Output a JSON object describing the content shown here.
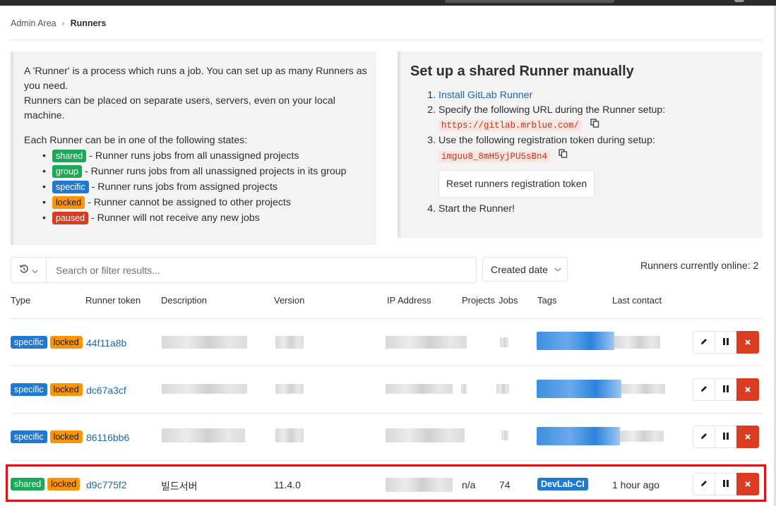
{
  "breadcrumb": {
    "parent": "Admin Area",
    "current": "Runners"
  },
  "info": {
    "line1": "A 'Runner' is a process which runs a job. You can set up as many Runners as you need.",
    "line2": "Runners can be placed on separate users, servers, even on your local machine.",
    "states_intro": "Each Runner can be in one of the following states:",
    "states": [
      {
        "badge": "shared",
        "text": "- Runner runs jobs from all unassigned projects"
      },
      {
        "badge": "group",
        "text": "- Runner runs jobs from all unassigned projects in its group"
      },
      {
        "badge": "specific",
        "text": "- Runner runs jobs from assigned projects"
      },
      {
        "badge": "locked",
        "text": "- Runner cannot be assigned to other projects"
      },
      {
        "badge": "paused",
        "text": "- Runner will not receive any new jobs"
      }
    ]
  },
  "setup": {
    "title": "Set up a shared Runner manually",
    "step1_link": "Install GitLab Runner",
    "step2_text": "Specify the following URL during the Runner setup:",
    "url": "https://gitlab.mrblue.com/",
    "step3_text": "Use the following registration token during setup:",
    "token": "imguu8_8mH5yjPU5sBn4",
    "reset_button": "Reset runners registration token",
    "step4_text": "Start the Runner!"
  },
  "filter": {
    "placeholder": "Search or filter results...",
    "sort_label": "Created date"
  },
  "online_text": "Runners currently online: 2",
  "columns": [
    "Type",
    "Runner token",
    "Description",
    "Version",
    "IP Address",
    "Projects",
    "Jobs",
    "Tags",
    "Last contact"
  ],
  "runners": [
    {
      "type": "specific",
      "locked": "locked",
      "token": "44f11a8b"
    },
    {
      "type": "specific",
      "locked": "locked",
      "token": "dc67a3cf"
    },
    {
      "type": "specific",
      "locked": "locked",
      "token": "86116bb6"
    },
    {
      "type": "shared",
      "locked": "locked",
      "token": "d9c775f2",
      "description": "빌드서버",
      "version": "11.4.0",
      "projects": "n/a",
      "jobs": "74",
      "tag": "DevLab-CI",
      "last_contact": "1 hour ago"
    }
  ],
  "colors": {
    "specific": "#1f78d1",
    "shared": "#1aaa55",
    "locked": "#fc9403",
    "paused": "#db3b21",
    "link": "#1b69b6",
    "highlight": "#d8141a"
  },
  "icons": [
    "history-icon",
    "chevron-down-icon",
    "copy-icon",
    "pencil-icon",
    "pause-icon",
    "close-icon"
  ]
}
